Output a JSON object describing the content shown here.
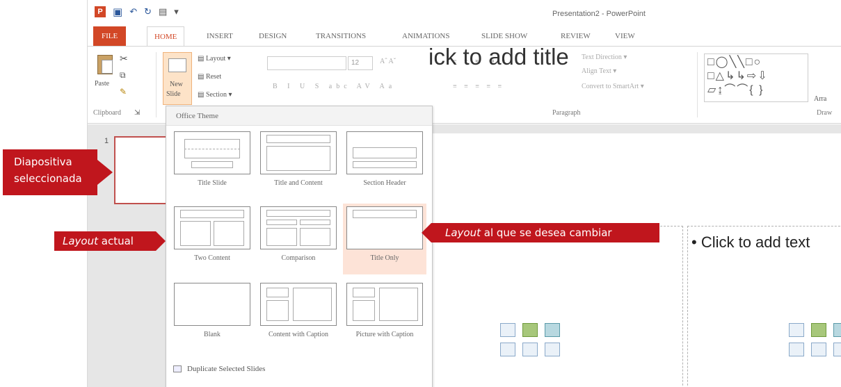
{
  "window": {
    "title": "Presentation2 - PowerPoint"
  },
  "tabs": [
    {
      "label": "FILE"
    },
    {
      "label": "HOME"
    },
    {
      "label": "INSERT"
    },
    {
      "label": "DESIGN"
    },
    {
      "label": "TRANSITIONS"
    },
    {
      "label": "ANIMATIONS"
    },
    {
      "label": "SLIDE SHOW"
    },
    {
      "label": "REVIEW"
    },
    {
      "label": "VIEW"
    }
  ],
  "ribbon": {
    "paste_label": "Paste",
    "new_slide_label_1": "New",
    "new_slide_label_2": "Slide",
    "layout_label": "Layout",
    "reset_label": "Reset",
    "section_label": "Section",
    "font_size": "12",
    "text_direction_label": "Text Direction",
    "align_text_label": "Align Text",
    "convert_smartart_label": "Convert to SmartArt",
    "clipboard_group": "Clipboard",
    "paragraph_group": "Paragraph",
    "drawing_group": "Draw",
    "arrange_label": "Arra"
  },
  "gallery": {
    "header": "Office Theme",
    "layouts": [
      {
        "label": "Title Slide"
      },
      {
        "label": "Title and Content"
      },
      {
        "label": "Section Header"
      },
      {
        "label": "Two Content"
      },
      {
        "label": "Comparison"
      },
      {
        "label": "Title Only"
      },
      {
        "label": "Blank"
      },
      {
        "label": "Content with Caption"
      },
      {
        "label": "Picture with Caption"
      }
    ],
    "menu": [
      {
        "label": "Duplicate Selected Slides"
      }
    ]
  },
  "slides": {
    "thumbnail_number": "1"
  },
  "slide": {
    "title_placeholder": "ick to add title",
    "content_placeholder": "• Click to add text"
  },
  "callouts": {
    "selected_line1": "Diapositiva",
    "selected_line2": "seleccionada",
    "current_em": "Layout",
    "current_rest": " actual",
    "target_em": "Layout",
    "target_rest": " al que se desea cambiar"
  },
  "colors": {
    "accent": "#d24726",
    "callout": "#c0161d",
    "hover": "#fde3d7"
  }
}
